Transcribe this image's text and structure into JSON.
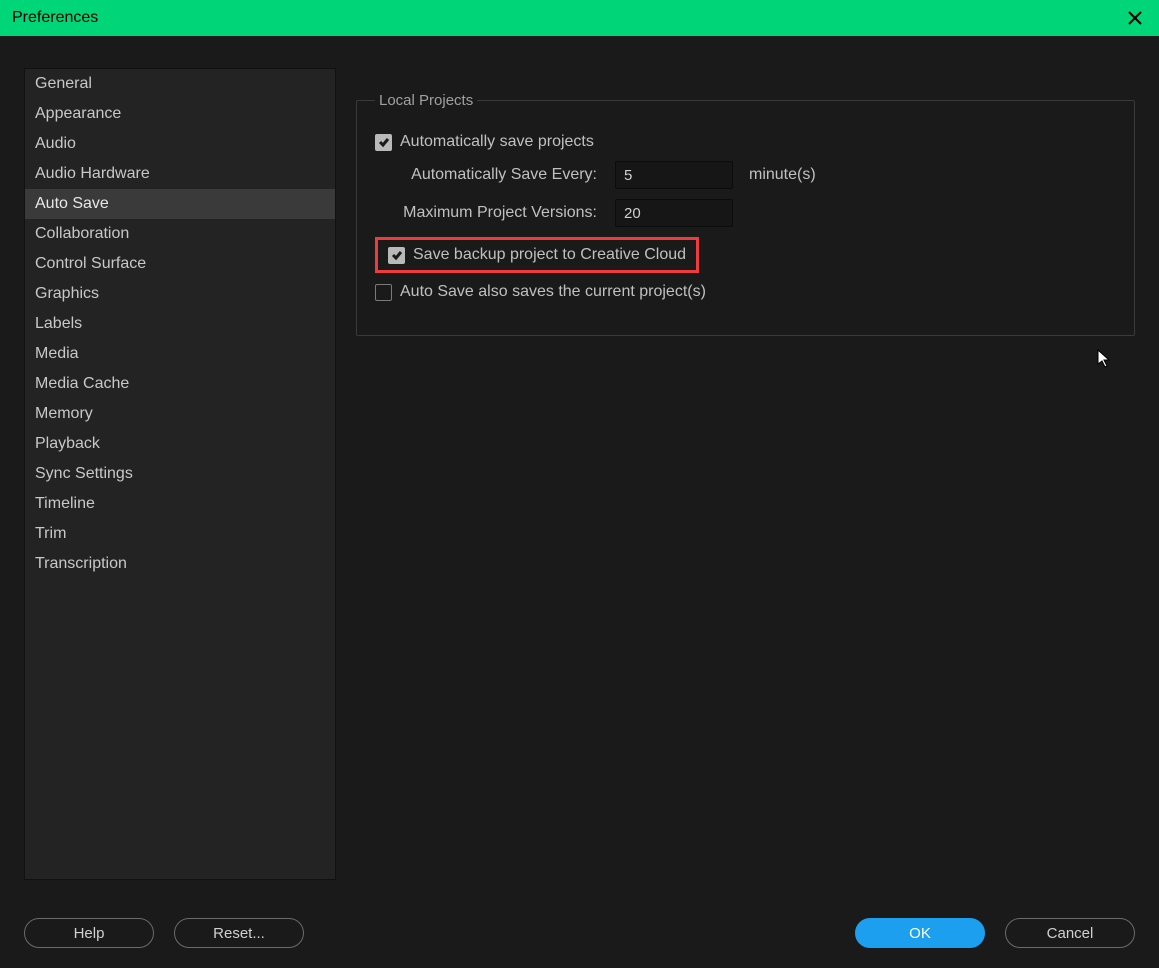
{
  "window": {
    "title": "Preferences"
  },
  "sidebar": {
    "items": [
      {
        "label": "General"
      },
      {
        "label": "Appearance"
      },
      {
        "label": "Audio"
      },
      {
        "label": "Audio Hardware"
      },
      {
        "label": "Auto Save",
        "selected": true
      },
      {
        "label": "Collaboration"
      },
      {
        "label": "Control Surface"
      },
      {
        "label": "Graphics"
      },
      {
        "label": "Labels"
      },
      {
        "label": "Media"
      },
      {
        "label": "Media Cache"
      },
      {
        "label": "Memory"
      },
      {
        "label": "Playback"
      },
      {
        "label": "Sync Settings"
      },
      {
        "label": "Timeline"
      },
      {
        "label": "Trim"
      },
      {
        "label": "Transcription"
      }
    ]
  },
  "panel": {
    "group_title": "Local Projects",
    "auto_save_checkbox": "Automatically save projects",
    "auto_save_checked": true,
    "save_every_label": "Automatically Save Every:",
    "save_every_value": "5",
    "save_every_unit": "minute(s)",
    "max_versions_label": "Maximum Project Versions:",
    "max_versions_value": "20",
    "backup_cc_label": "Save backup project to Creative Cloud",
    "backup_cc_checked": true,
    "also_current_label": "Auto Save also saves the current project(s)",
    "also_current_checked": false
  },
  "footer": {
    "help": "Help",
    "reset": "Reset...",
    "ok": "OK",
    "cancel": "Cancel"
  },
  "colors": {
    "accent_titlebar": "#00d577",
    "highlight_box": "#ef3b3b",
    "primary_button": "#1d9ff0"
  }
}
